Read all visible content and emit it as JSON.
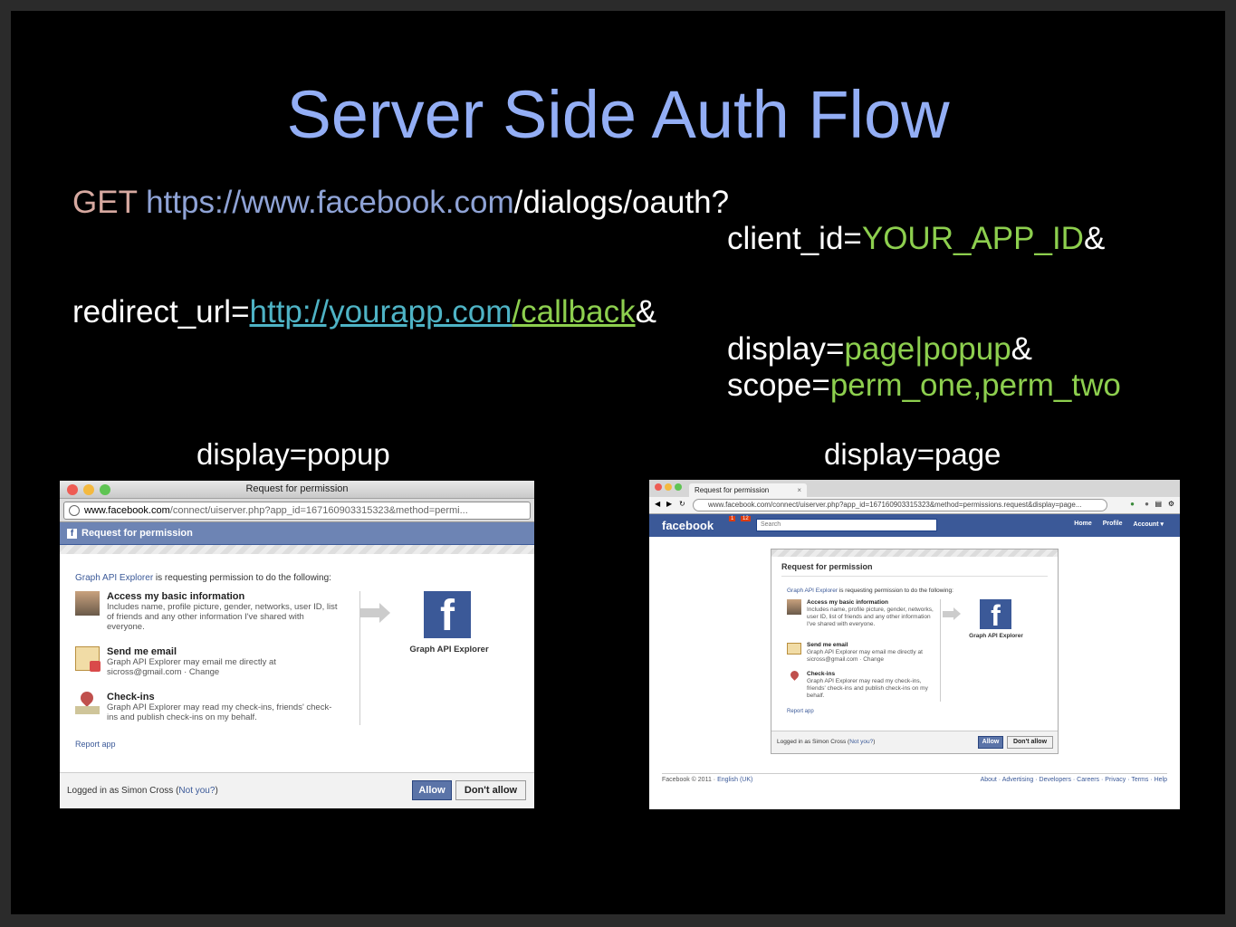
{
  "slide": {
    "title": "Server Side Auth Flow",
    "request": {
      "method": "GET",
      "host": "https://www.facebook.com",
      "path": "/dialogs/oauth?",
      "client_id_key": "client_id=",
      "client_id_val": "YOUR_APP_ID",
      "amp": "&",
      "redirect_key": "redirect_url=",
      "redirect_host": "http://yourapp.com",
      "redirect_path": "/callback",
      "display_key": "display=",
      "display_val": "page|popup",
      "scope_key": "scope=",
      "scope_val": "perm_one,perm_two"
    },
    "caption_popup": "display=popup",
    "caption_page": "display=page"
  },
  "popup": {
    "window_title": "Request for permission",
    "url_host": "www.facebook.com",
    "url_rest": "/connect/uiserver.php?app_id=167160903315323&method=permi...",
    "header": "Request for permission",
    "app_name": "Graph API Explorer",
    "intro": " is requesting permission to do the following:",
    "perms": [
      {
        "title": "Access my basic information",
        "desc": "Includes name, profile picture, gender, networks, user ID, list of friends and any other information I've shared with everyone."
      },
      {
        "title": "Send me email",
        "desc": "Graph API Explorer may email me directly at sicross@gmail.com · Change"
      },
      {
        "title": "Check-ins",
        "desc": "Graph API Explorer may read my check-ins, friends' check-ins and publish check-ins on my behalf."
      }
    ],
    "app_label": "Graph API Explorer",
    "report": "Report app",
    "logged_in": "Logged in as Simon Cross (",
    "not_you": "Not you?",
    "logged_in_end": ")",
    "allow": "Allow",
    "deny": "Don't allow"
  },
  "page": {
    "tab_title": "Request for permission",
    "url": "www.facebook.com/connect/uiserver.php?app_id=167160903315323&method=permissions.request&display=page...",
    "wordmark": "facebook",
    "search_placeholder": "Search",
    "nav": [
      "Home",
      "Profile",
      "Account ▾"
    ],
    "badges": [
      "1",
      "12"
    ],
    "header": "Request for permission",
    "app_name": "Graph API Explorer",
    "intro": " is requesting permission to do the following:",
    "perms": [
      {
        "title": "Access my basic information",
        "desc": "Includes name, profile picture, gender, networks, user ID, list of friends and any other information I've shared with everyone."
      },
      {
        "title": "Send me email",
        "desc": "Graph API Explorer may email me directly at sicross@gmail.com · Change"
      },
      {
        "title": "Check-ins",
        "desc": "Graph API Explorer may read my check-ins, friends' check-ins and publish check-ins on my behalf."
      }
    ],
    "app_label": "Graph API Explorer",
    "report": "Report app",
    "logged_in": "Logged in as Simon Cross (",
    "not_you": "Not you?",
    "logged_in_end": ")",
    "allow": "Allow",
    "deny": "Don't allow",
    "footer_left": "Facebook © 2011 · ",
    "footer_lang": "English (UK)",
    "footer_right": "About · Advertising · Developers · Careers · Privacy · Terms · Help"
  }
}
